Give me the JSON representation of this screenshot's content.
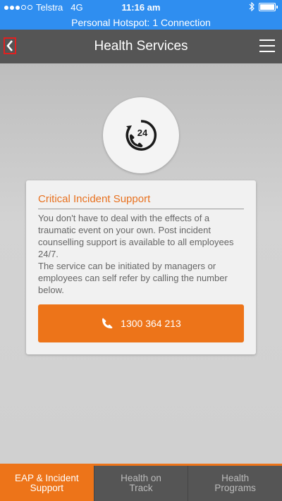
{
  "status_bar": {
    "carrier": "Telstra",
    "network": "4G",
    "time": "11:16 am",
    "icons": [
      "signal-icon",
      "bluetooth-icon",
      "battery-icon"
    ]
  },
  "hotspot_banner": "Personal Hotspot: 1 Connection",
  "navbar": {
    "title": "Health Services",
    "icons": [
      "back-icon",
      "menu-icon"
    ]
  },
  "main": {
    "hero_icon": "phone-24-hours-icon",
    "card": {
      "title": "Critical Incident Support",
      "paragraph1": "You don't have to deal with the effects of a traumatic event on your own. Post incident counselling support is available to all employees 24/7.",
      "paragraph2": "The service can be initiated by managers or employees can self refer by calling the number below.",
      "call_button": "1300 364 213"
    }
  },
  "tabbar": {
    "tabs": [
      {
        "label_line1": "EAP & Incident",
        "label_line2": "Support",
        "active": true
      },
      {
        "label_line1": "Health on",
        "label_line2": "Track",
        "active": false
      },
      {
        "label_line1": "Health",
        "label_line2": "Programs",
        "active": false
      }
    ]
  },
  "colors": {
    "accent": "#ed7419",
    "status_bar": "#2f8ef0",
    "nav": "#555555"
  }
}
